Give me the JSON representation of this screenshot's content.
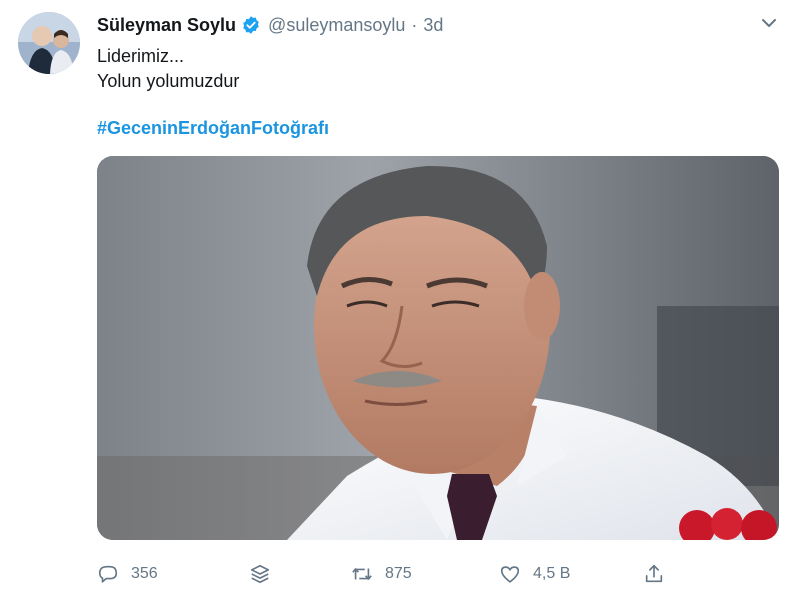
{
  "tweet": {
    "author": {
      "display_name": "Süleyman Soylu",
      "handle": "@suleymansoylu",
      "verified": true,
      "avatar_icon": "profile-photo"
    },
    "separator": "·",
    "time": "3d",
    "text_lines": [
      "Liderimiz...",
      "Yolun yolumuzdur"
    ],
    "hashtag": "#GeceninErdoğanFotoğrafı",
    "media": {
      "kind": "photo",
      "description_icon": "portrait-photo"
    },
    "actions": {
      "reply": {
        "icon": "reply-icon",
        "count": "356"
      },
      "stack": {
        "icon": "layers-icon"
      },
      "retweet": {
        "icon": "retweet-icon",
        "count": "875"
      },
      "like": {
        "icon": "heart-icon",
        "count": "4,5 B"
      },
      "share": {
        "icon": "share-icon"
      }
    }
  },
  "colors": {
    "link": "#1b95e0",
    "verified": "#1da1f2",
    "secondary_text": "#657786",
    "primary_text": "#14171a"
  }
}
